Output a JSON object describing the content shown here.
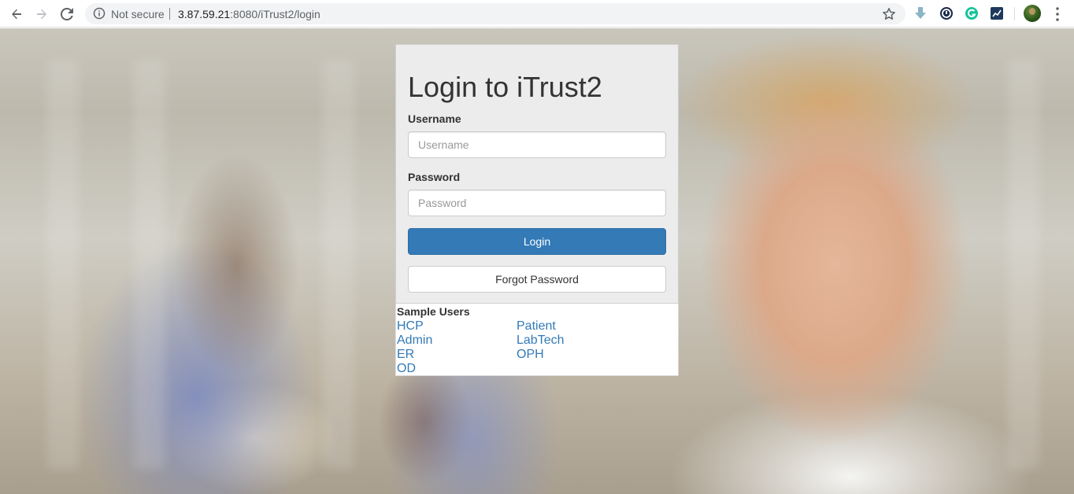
{
  "browser": {
    "security_label": "Not secure",
    "url_host": "3.87.59.21",
    "url_path": ":8080/iTrust2/login"
  },
  "login": {
    "title": "Login to iTrust2",
    "username_label": "Username",
    "username_placeholder": "Username",
    "password_label": "Password",
    "password_placeholder": "Password",
    "login_button": "Login",
    "forgot_button": "Forgot Password"
  },
  "sample_users": {
    "title": "Sample Users",
    "left_column": [
      "HCP",
      "Admin",
      "ER",
      "OD"
    ],
    "right_column": [
      "Patient",
      "LabTech",
      "OPH"
    ]
  },
  "colors": {
    "primary": "#337ab7",
    "card_background": "#ececec",
    "link": "#337ab7"
  }
}
